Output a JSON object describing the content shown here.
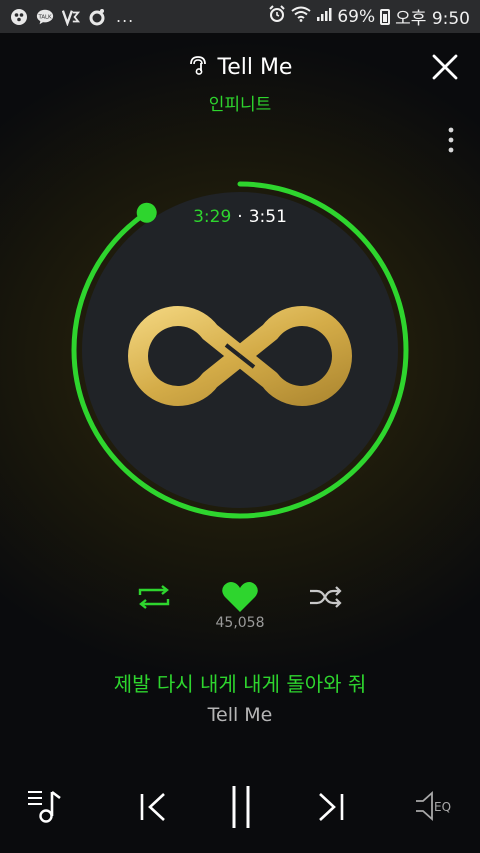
{
  "status_bar": {
    "left_icons": [
      "bbm-icon",
      "kakaotalk-icon",
      "v3-icon",
      "ring-icon"
    ],
    "kakao_label": "TALK",
    "more_dots": "...",
    "battery_percent": "69%",
    "time": "오후 9:50",
    "right_icons": [
      "alarm-icon",
      "wifi-icon",
      "signal-icon",
      "battery-icon"
    ]
  },
  "header": {
    "song_title": "Tell Me",
    "artist": "인피니트"
  },
  "player": {
    "current_time": "3:29",
    "separator": "·",
    "total_time": "3:51",
    "progress": 0.905,
    "like_count": "45,058",
    "liked": true
  },
  "lyrics": {
    "current": "제발 다시 내게 내게 돌아와 줘",
    "next": "Tell Me"
  },
  "controls": {
    "eq_label": "EQ"
  },
  "colors": {
    "accent": "#2ed52e",
    "logo_gold": "#d9b552",
    "disc": "#202327"
  }
}
